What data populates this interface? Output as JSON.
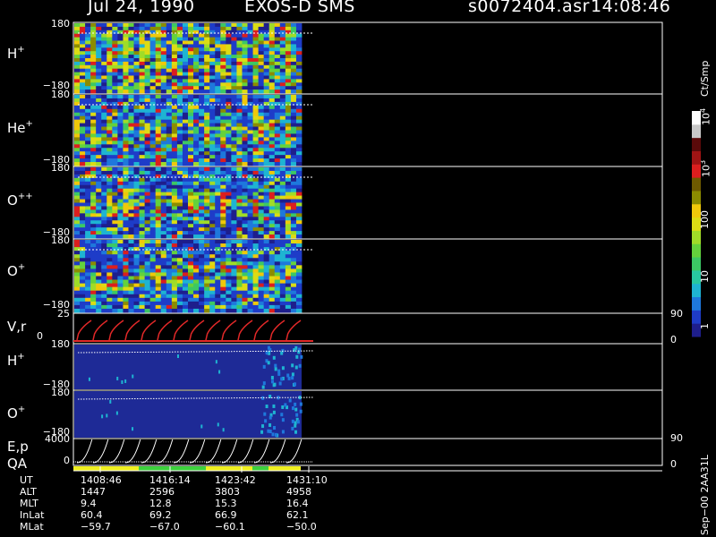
{
  "header": {
    "date": "Jul 24, 1990",
    "instrument": "EXOS-D SMS",
    "file": "s0072404.asr",
    "time": "14:08:46"
  },
  "colorbar": {
    "unit_label": "Ct/Smp",
    "ticks": [
      "10",
      "10",
      "100",
      "10",
      "1"
    ],
    "tick_exponents": [
      "4",
      "3"
    ],
    "colors": [
      "#1e1e8c",
      "#1e3cc8",
      "#1e78dc",
      "#1eb4d2",
      "#28c8a0",
      "#3cc864",
      "#64d23c",
      "#a0dc28",
      "#dcdc14",
      "#f0c80a",
      "#8c8c00",
      "#6e5a00",
      "#dc1e1e",
      "#a01414",
      "#5a0a0a",
      "#c8c8c8",
      "#ffffff"
    ]
  },
  "panels": [
    {
      "id": "h-plus",
      "name": "H",
      "sup": "+",
      "top_tick": "180",
      "bottom_tick": "−180"
    },
    {
      "id": "he-plus",
      "name": "He",
      "sup": "+",
      "top_tick": "180",
      "bottom_tick": "−180"
    },
    {
      "id": "o-plusplus",
      "name": "O",
      "sup": "++",
      "top_tick": "180",
      "bottom_tick": "−180"
    },
    {
      "id": "o-plus",
      "name": "O",
      "sup": "+",
      "top_tick": "180",
      "bottom_tick": "−180"
    }
  ],
  "vr_panel": {
    "label": "V,r",
    "top_tick": "25",
    "bottom_tick": "0",
    "right_top": "90",
    "right_bottom": "0"
  },
  "h2_panel": {
    "name": "H",
    "sup": "+",
    "top_tick": "180",
    "bottom_tick": "−180"
  },
  "o2_panel": {
    "name": "O",
    "sup": "+",
    "top_tick": "180",
    "bottom_tick": "−180"
  },
  "ep_panel": {
    "label1": "E,p",
    "label2": "QA",
    "top_tick": "4000",
    "bottom_tick": "0",
    "right_top": "90",
    "right_bottom": "0"
  },
  "qa_colors": [
    "#f0f01e",
    "#3cd23c",
    "#f0f01e",
    "#3cd23c",
    "#f0f01e"
  ],
  "ephemeris": {
    "rows": [
      {
        "label": "UT",
        "values": [
          "1408:46",
          "1416:14",
          "1423:42",
          "1431:10"
        ]
      },
      {
        "label": "ALT",
        "values": [
          "1447",
          "2596",
          "3803",
          "4958"
        ]
      },
      {
        "label": "MLT",
        "values": [
          "9.4",
          "12.8",
          "15.3",
          "16.4"
        ]
      },
      {
        "label": "InLat",
        "values": [
          "60.4",
          "69.2",
          "66.9",
          "62.1"
        ]
      },
      {
        "label": "MLat",
        "values": [
          "−59.7",
          "−67.0",
          "−60.1",
          "−50.0"
        ]
      }
    ]
  },
  "footer_note": "Sep−00 2AA31L",
  "chart_data": {
    "type": "heatmap",
    "x_label": "UT",
    "x_ticks": [
      "1408:46",
      "1416:14",
      "1423:42",
      "1431:10"
    ],
    "y_range": [
      -180,
      180
    ],
    "colorbar_range": [
      1,
      10000
    ],
    "colorbar_scale": "log",
    "series": [
      {
        "name": "H+"
      },
      {
        "name": "He+"
      },
      {
        "name": "O++"
      },
      {
        "name": "O+"
      }
    ]
  }
}
